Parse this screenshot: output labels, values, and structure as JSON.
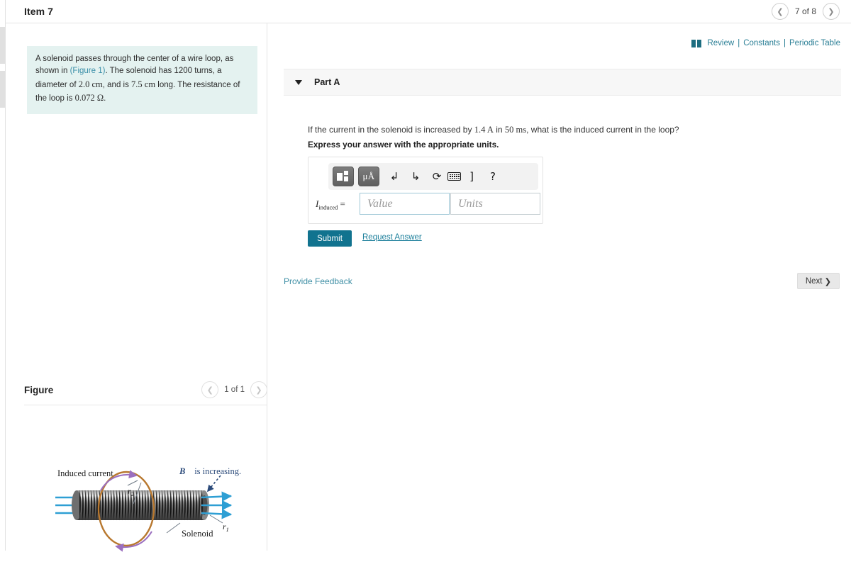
{
  "header": {
    "item_title": "Item 7",
    "pager": {
      "prev_icon": "chevron-left-icon",
      "label": "7 of 8",
      "next_icon": "chevron-right-icon"
    }
  },
  "problem": {
    "text_before_link": "A solenoid passes through the center of a wire loop, as shown in ",
    "figure_link": "(Figure 1)",
    "text_mid": ". The solenoid has 1200 turns, a diameter of ",
    "diameter": "2.0 cm",
    "text_mid2": ", and is ",
    "length": "7.5 cm",
    "text_mid3": " long. The resistance of the loop is ",
    "resistance": "0.072 Ω",
    "text_end": "."
  },
  "reflinks": {
    "icon": "book-icon",
    "review": "Review",
    "sep1": "|",
    "constants": "Constants",
    "sep2": "|",
    "periodic_table": "Periodic Table"
  },
  "part": {
    "caret_icon": "chevron-down-icon",
    "label": "Part A",
    "question_a": "If the current in the solenoid is increased by ",
    "current": "1.4 A",
    "question_b": " in ",
    "time": "50 ms",
    "question_c": ", what is the induced current in the loop?",
    "instruction": "Express your answer with the appropriate units."
  },
  "answer": {
    "toolbar": {
      "template_icon": "template-layout-icon",
      "units_label": "μÅ",
      "undo_icon": "undo-arrow-icon",
      "redo_icon": "redo-arrow-icon",
      "reset_icon": "reset-circular-arrow-icon",
      "keyboard_icon": "keyboard-icon",
      "bracket": "]",
      "help_icon": "?"
    },
    "variable": "I",
    "variable_sub": "induced",
    "equals": "=",
    "value_placeholder": "Value",
    "units_placeholder": "Units",
    "submit_label": "Submit",
    "request_answer_label": "Request Answer"
  },
  "footer": {
    "feedback_label": "Provide Feedback",
    "next_label": "Next",
    "next_icon": "chevron-right-icon"
  },
  "figure": {
    "title": "Figure",
    "pager": {
      "prev_icon": "chevron-left-icon",
      "label": "1 of 1",
      "next_icon": "chevron-right-icon"
    },
    "labels": {
      "induced_current": "Induced current",
      "b_field": "B is increasing.",
      "b_symbol": "B",
      "r2": "r",
      "r2_sub": "2",
      "r1": "r",
      "r1_sub": "1",
      "solenoid": "Solenoid"
    },
    "colors": {
      "field_line": "#2e9fd4",
      "loop_wire": "#b8782f",
      "current_arrow": "#9b6fbf",
      "coil_dark": "#4a4a4a",
      "coil_light": "#d8d8d8"
    }
  },
  "theme": {
    "accent_teal": "#11738f",
    "link_teal": "#2b7f96",
    "problem_bg": "#e4f2f0",
    "panel_gray": "#f7f7f7"
  }
}
